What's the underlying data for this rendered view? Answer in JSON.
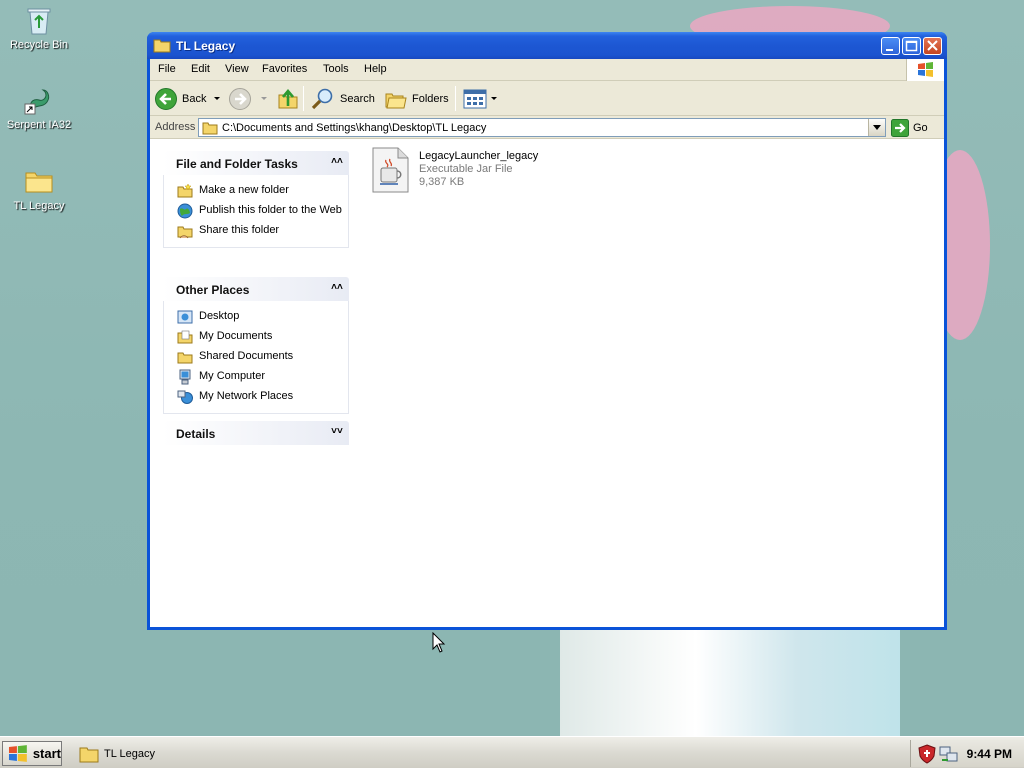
{
  "desktop": {
    "icons": [
      {
        "label": "Recycle Bin",
        "icon": "recycle-bin-icon"
      },
      {
        "label": "Serpent IA32",
        "icon": "serpent-shortcut-icon"
      },
      {
        "label": "TL Legacy",
        "icon": "folder-icon"
      }
    ]
  },
  "window": {
    "title": "TL Legacy",
    "menu": [
      "File",
      "Edit",
      "View",
      "Favorites",
      "Tools",
      "Help"
    ],
    "toolbar": {
      "back_label": "Back",
      "search_label": "Search",
      "folders_label": "Folders"
    },
    "address": {
      "label": "Address",
      "value": "C:\\Documents and Settings\\khang\\Desktop\\TL Legacy",
      "go_label": "Go"
    },
    "panels": {
      "file_tasks": {
        "title": "File and Folder Tasks",
        "items": [
          "Make a new folder",
          "Publish this folder to the Web",
          "Share this folder"
        ]
      },
      "other_places": {
        "title": "Other Places",
        "items": [
          "Desktop",
          "My Documents",
          "Shared Documents",
          "My Computer",
          "My Network Places"
        ]
      },
      "details": {
        "title": "Details"
      }
    },
    "files": [
      {
        "name": "LegacyLauncher_legacy",
        "type": "Executable Jar File",
        "size": "9,387 KB",
        "icon": "jar-file-icon"
      }
    ]
  },
  "taskbar": {
    "start_label": "start",
    "task_label": "TL Legacy",
    "clock": "9:44 PM"
  },
  "colors": {
    "titlebar": "#1d57d3",
    "desktop": "#8fb8b4",
    "chrome": "#ece9d8"
  }
}
